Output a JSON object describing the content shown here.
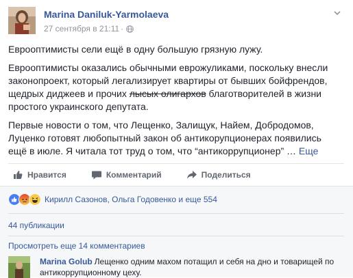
{
  "post": {
    "author": "Marina Daniluk-Yarmolaeva",
    "timestamp": "27 сентября в 21:11",
    "separator": "·",
    "privacy_icon": "globe-icon",
    "menu_icon": "chevron-down-icon",
    "paragraphs": {
      "p1": "Еврооптимисты сели ещё в одну большую грязную лужу.",
      "p2_before": "Еврооптимисты оказались обычными еврожуликами, поскольку внесли законопроект, который легализирует квартиры от бывших бойфрендов, щедрых диджеев и прочих ",
      "p2_strike": "лысых олигархов",
      "p2_after": " благотворителей в жизни простого украинского депутата.",
      "p3": "Первые новости о том, что Лещенко, Залищук, Найем, Добродомов, Луценко готовят любопытный закон об антикорупционерах появились ещё в июле. Я читала тот труд о том, что “антикоррупционер” … ",
      "see_more": "Еще"
    }
  },
  "actions": {
    "like": "Нравится",
    "comment": "Комментарий",
    "share": "Поделиться"
  },
  "reactions": {
    "icons": [
      "like-reaction-icon",
      "angry-reaction-icon",
      "haha-reaction-icon"
    ],
    "text": "Кирилл Сазонов, Ольга Годовенко и еще 554"
  },
  "shares": "44 публикации",
  "view_more_comments": "Просмотреть еще 14 комментариев",
  "comment": {
    "author": "Marina Golub",
    "text": "Лещенко одним махом потащил и себя на дно и товарищей по антикоррупционному цеху."
  },
  "colors": {
    "link": "#365899",
    "text": "#1d2129",
    "meta": "#90949c",
    "comments_bg": "#f6f7f9"
  }
}
